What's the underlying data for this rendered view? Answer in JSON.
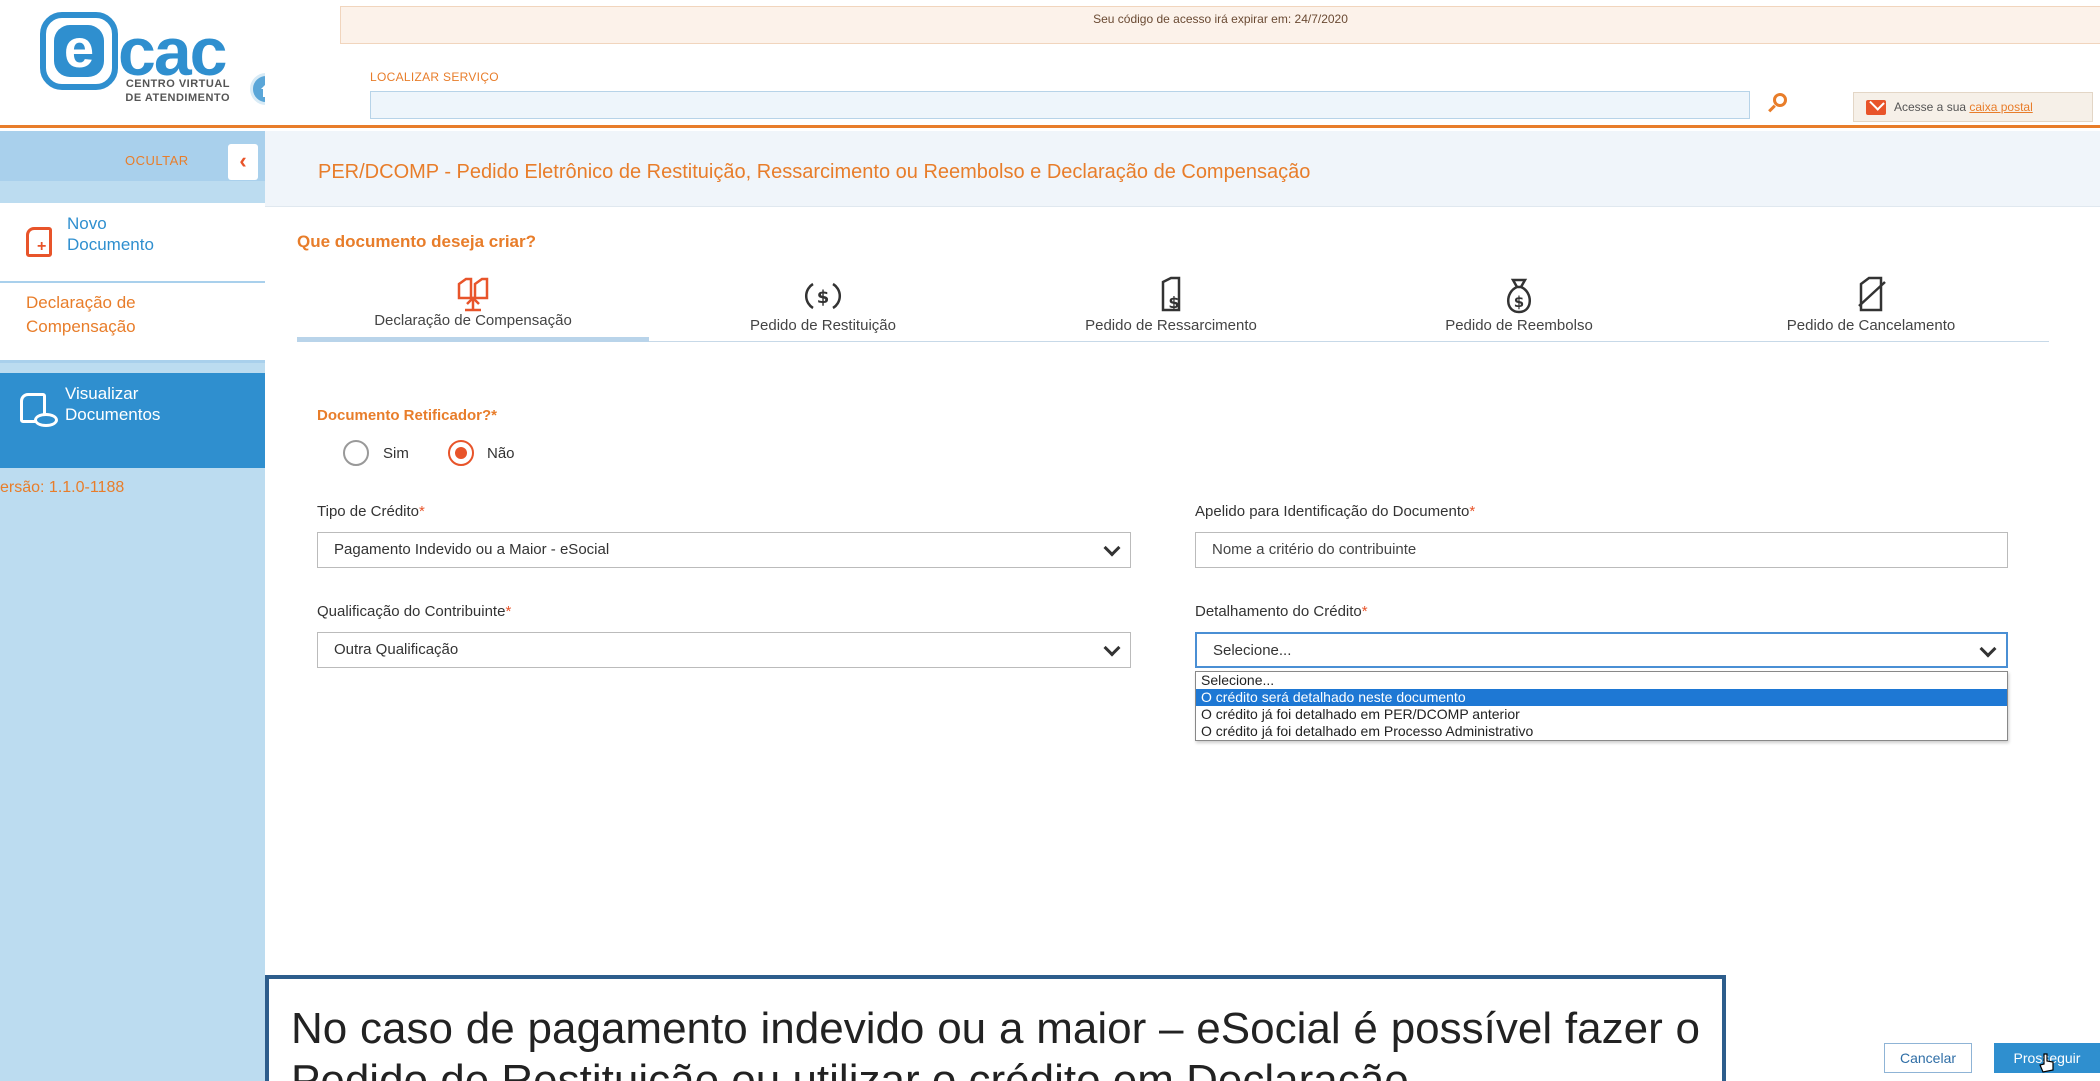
{
  "header": {
    "logo_word": "cac",
    "logo_letter": "e",
    "logo_sub1": "CENTRO VIRTUAL",
    "logo_sub2": "DE ATENDIMENTO",
    "expire_notice": "Seu código de acesso irá expirar em: 24/7/2020",
    "search_label": "LOCALIZAR SERVIÇO",
    "search_value": "",
    "mailbox_prefix": "Acesse a sua ",
    "mailbox_link": "caixa postal"
  },
  "sidebar": {
    "hide_label": "OCULTAR",
    "hide_glyph": "‹",
    "new_doc_label_1": "Novo",
    "new_doc_label_2": "Documento",
    "decl_label_1": "Declaração de",
    "decl_label_2": "Compensação",
    "view_label_1": "Visualizar",
    "view_label_2": "Documentos",
    "version": "ersão: 1.1.0-1188"
  },
  "main": {
    "page_title": "PER/DCOMP - Pedido Eletrônico de Restituição, Ressarcimento ou Reembolso e Declaração de Compensação",
    "question": "Que documento deseja criar?",
    "tabs": [
      {
        "label": "Declaração de Compensação",
        "icon": "compensation-icon",
        "active": true
      },
      {
        "label": "Pedido de Restituição",
        "icon": "restitution-icon",
        "active": false
      },
      {
        "label": "Pedido de Ressarcimento",
        "icon": "reimbursement-doc-icon",
        "active": false
      },
      {
        "label": "Pedido de Reembolso",
        "icon": "money-bag-icon",
        "active": false
      },
      {
        "label": "Pedido de Cancelamento",
        "icon": "cancel-doc-icon",
        "active": false
      }
    ],
    "retificador_label": "Documento Retificador?*",
    "radio_yes": "Sim",
    "radio_no": "Não",
    "radio_selected": "Não",
    "tipo_credito_label": "Tipo de Crédito",
    "tipo_credito_value": "Pagamento Indevido ou a Maior - eSocial",
    "apelido_label": "Apelido para Identificação do Documento",
    "apelido_placeholder": "Nome a critério do contribuinte",
    "qualificacao_label": "Qualificação do Contribuinte",
    "qualificacao_value": "Outra Qualificação",
    "detalhamento_label": "Detalhamento do Crédito",
    "detalhamento_value": "Selecione...",
    "detalhamento_options": [
      "Selecione...",
      "O crédito será detalhado neste documento",
      "O crédito já foi detalhado em PER/DCOMP anterior",
      "O crédito já foi detalhado em Processo Administrativo"
    ],
    "detalhamento_highlighted_index": 1,
    "required_mark": "*",
    "cancel_label": "Cancelar",
    "next_label": "Prosseguir"
  },
  "caption": {
    "text": "No caso de pagamento indevido ou a maior – eSocial é possível fazer o Pedido de Restituição ou utilizar o crédito em Declaração"
  },
  "colors": {
    "accent_orange": "#e87d2a",
    "brand_blue": "#2f8fcf",
    "sidebar_bg": "#bcdcf0",
    "highlight_blue": "#1e78d4"
  }
}
